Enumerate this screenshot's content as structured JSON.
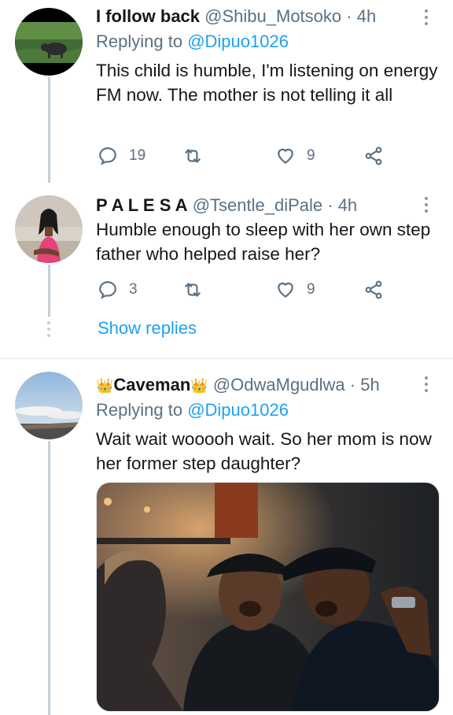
{
  "tweets": [
    {
      "name": "I follow back",
      "handle": "@Shibu_Motsoko",
      "time": "· 4h",
      "replying_label": "Replying to",
      "replying_handle": "@Dipuo1026",
      "text": "This child is humble, I'm listening on energy FM now. The mother is not telling it all",
      "replies": "19",
      "retweets": "",
      "likes": "9"
    },
    {
      "name": "P A L E S A",
      "handle": "@Tsentle_diPale",
      "time": "· 4h",
      "text": "Humble enough to sleep with her own step father who helped raise her?",
      "replies": "3",
      "retweets": "",
      "likes": "9"
    },
    {
      "name_crown_left": "👑",
      "name": "Caveman",
      "name_crown_right": "👑",
      "handle": "@OdwaMgudlwa",
      "time": "· 5h",
      "replying_label": "Replying to",
      "replying_handle": "@Dipuo1026",
      "text": "Wait wait wooooh wait. So her mom is now her former step daughter?"
    }
  ],
  "show_replies": "Show replies",
  "icons": {
    "reply": "reply-icon",
    "retweet": "retweet-icon",
    "like": "heart-icon",
    "share": "share-icon",
    "more": "more-vertical-icon"
  },
  "colors": {
    "link": "#1da1f2",
    "muted": "#5b7083",
    "line": "#c4cfd6"
  }
}
